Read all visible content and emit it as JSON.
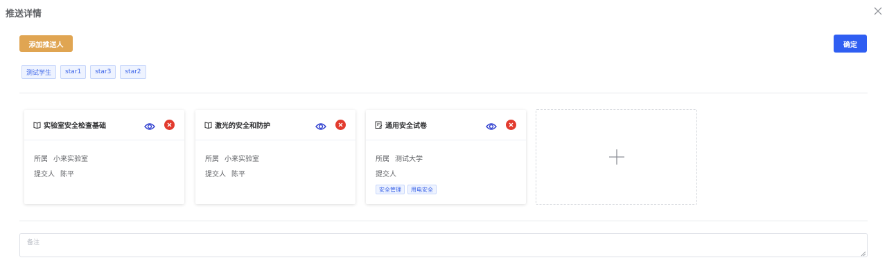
{
  "dialog": {
    "title": "推送详情"
  },
  "toolbar": {
    "add_label": "添加推送人",
    "confirm_label": "确定"
  },
  "recipients": [
    "测试学生",
    "star1",
    "star3",
    "star2"
  ],
  "cards": [
    {
      "icon": "book-icon",
      "title": "实验室安全检查基础",
      "owner_key": "所属",
      "owner": "小来实验室",
      "submitter_key": "提交人",
      "submitter": "陈平",
      "tags": []
    },
    {
      "icon": "book-icon",
      "title": "激光的安全和防护",
      "owner_key": "所属",
      "owner": "小来实验室",
      "submitter_key": "提交人",
      "submitter": "陈平",
      "tags": []
    },
    {
      "icon": "exam-paper-icon",
      "title": "通用安全试卷",
      "owner_key": "所属",
      "owner": "测试大学",
      "submitter_key": "提交人",
      "submitter": "",
      "tags": [
        "安全管理",
        "用电安全"
      ]
    }
  ],
  "remark": {
    "placeholder": "备注",
    "value": ""
  },
  "colors": {
    "primary": "#2f5ef2",
    "warning": "#e0a552",
    "danger": "#e23b2e",
    "eye": "#2f3fcf"
  }
}
